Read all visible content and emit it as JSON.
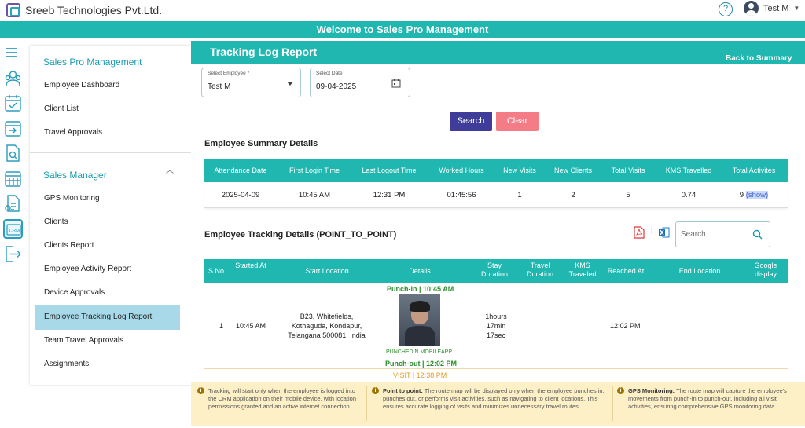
{
  "header": {
    "company": "Sreeb Technologies Pvt.Ltd.",
    "user_name": "Test M",
    "banner": "Welcome to Sales Pro Management"
  },
  "sidebar": {
    "group1_title": "Sales Pro Management",
    "group1_items": [
      "Employee Dashboard",
      "Client List",
      "Travel Approvals"
    ],
    "group2_title": "Sales Manager",
    "group2_items": [
      "GPS Monitoring",
      "Clients",
      "Clients Report",
      "Employee Activity Report",
      "Device Approvals",
      "Employee Tracking Log Report",
      "Team Travel Approvals",
      "Assignments"
    ],
    "active_item": "Employee Tracking Log Report"
  },
  "page": {
    "title": "Tracking Log Report",
    "back_label": "Back to Summary"
  },
  "filters": {
    "employee_label": "Select Employee *",
    "employee_value": "Test M",
    "date_label": "Select Date",
    "date_value": "09-04-2025",
    "search_label": "Search",
    "clear_label": "Clear"
  },
  "summary": {
    "title": "Employee Summary Details",
    "headers": [
      "Attendance Date",
      "First Login Time",
      "Last Logout Time",
      "Worked Hours",
      "New Visits",
      "New Clients",
      "Total Visits",
      "KMS Travelled",
      "Total Activites"
    ],
    "row": [
      "2025-04-09",
      "10:45 AM",
      "12:31 PM",
      "01:45:56",
      "1",
      "2",
      "5",
      "0.74",
      "9"
    ],
    "show_label": "(show)"
  },
  "tracking": {
    "title": "Employee Tracking Details (POINT_TO_POINT)",
    "search_placeholder": "Search",
    "pipe": "|",
    "headers": [
      "S.No",
      "Started At",
      "Start Location",
      "Details",
      "Stay Duration",
      "Travel Duration",
      "KMS Traveled",
      "Reached At",
      "End Location",
      "Google display"
    ],
    "row": {
      "sno": "1",
      "started_at": "10:45 AM",
      "location_lines": [
        "B23, Whitefields,",
        "Kothaguda, Kondapur,",
        "Telangana 500081, India"
      ],
      "punch_in": "Punch-in | 10:45 AM",
      "punched_in_label": "PUNCHEDIN MOBILEAPP",
      "punch_out": "Punch-out | 12:02 PM",
      "stay_lines": [
        "1hours",
        "17min",
        "17sec"
      ],
      "reached_at": "12:02 PM"
    },
    "visit": "VISIT | 12:38 PM"
  },
  "notes": {
    "n1_text": "Tracking will start only when the employee is logged into the CRM application on their mobile device, with location permissions granted and an active internet connection.",
    "n2_title": "Point to point:",
    "n2_text": "The route map will be displayed only when the employee punches in, punches out, or performs visit activities, such as navigating to client locations. This ensures accurate logging of visits and minimizes unnecessary travel routes.",
    "n3_title": "GPS Monitoring:",
    "n3_text": "The route map will capture the employee's movements from punch-in to punch-out, including all visit activities, ensuring comprehensive GPS monitoring data."
  },
  "colors": {
    "teal": "#1fb7b0",
    "search_button": "#3f3d99",
    "clear_button": "#f47c86",
    "active_menu": "#a8d9e8"
  },
  "icons": [
    "help-icon",
    "hamburger-icon",
    "people-gear-icon",
    "calendar-check-icon",
    "calendar-transfer-icon",
    "document-search-icon",
    "calendar-grid-icon",
    "document-money-icon",
    "crm-icon",
    "logout-icon",
    "pdf-export-icon",
    "excel-export-icon",
    "search-icon"
  ]
}
